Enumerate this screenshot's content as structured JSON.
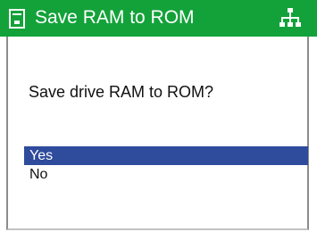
{
  "window": {
    "title": "Save RAM to ROM",
    "left_icon": "device-save-icon",
    "right_icon": "network-icon"
  },
  "dialog": {
    "question": "Save drive RAM to ROM?",
    "options": [
      {
        "label": "Yes",
        "selected": true
      },
      {
        "label": "No",
        "selected": false
      }
    ]
  },
  "colors": {
    "titlebar": "#13a23a",
    "selection": "#2e4b9c"
  }
}
